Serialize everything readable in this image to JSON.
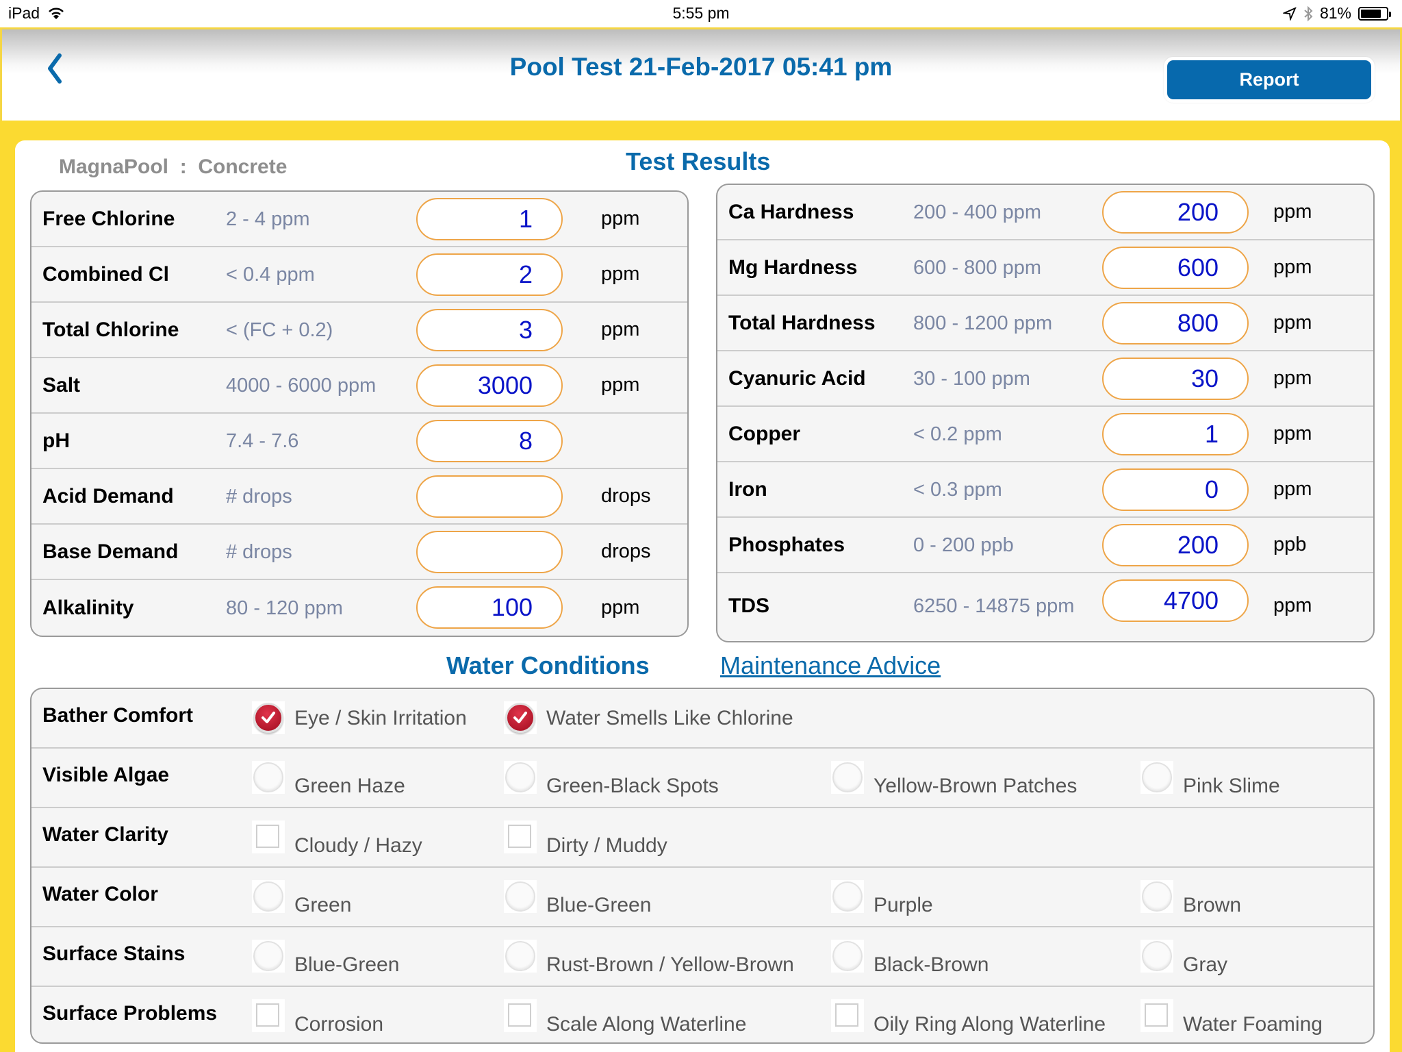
{
  "status_bar": {
    "device": "iPad",
    "time": "5:55 pm",
    "battery_percent": "81%",
    "battery_level": 0.81
  },
  "nav": {
    "back_icon": "chevron-left-icon",
    "title": "Pool Test 21-Feb-2017 05:41 pm",
    "report_label": "Report"
  },
  "pool_info": {
    "name": "MagnaPool",
    "separator": ":",
    "surface": "Concrete"
  },
  "test_results": {
    "title": "Test Results",
    "left": [
      {
        "name": "Free Chlorine",
        "range": "2 - 4 ppm",
        "value": "1",
        "unit": "ppm"
      },
      {
        "name": "Combined Cl",
        "range": "< 0.4 ppm",
        "value": "2",
        "unit": "ppm"
      },
      {
        "name": "Total Chlorine",
        "range": "< (FC + 0.2)",
        "value": "3",
        "unit": "ppm"
      },
      {
        "name": "Salt",
        "range": "4000 - 6000 ppm",
        "value": "3000",
        "unit": "ppm"
      },
      {
        "name": "pH",
        "range": "7.4 - 7.6",
        "value": "8",
        "unit": ""
      },
      {
        "name": "Acid Demand",
        "range": "# drops",
        "value": "",
        "unit": "drops"
      },
      {
        "name": "Base Demand",
        "range": "# drops",
        "value": "",
        "unit": "drops"
      },
      {
        "name": "Alkalinity",
        "range": "80 - 120 ppm",
        "value": "100",
        "unit": "ppm"
      }
    ],
    "right": [
      {
        "name": "Ca Hardness",
        "range": "200 - 400 ppm",
        "value": "200",
        "unit": "ppm"
      },
      {
        "name": "Mg Hardness",
        "range": "600 - 800 ppm",
        "value": "600",
        "unit": "ppm"
      },
      {
        "name": "Total Hardness",
        "range": "800 - 1200 ppm",
        "value": "800",
        "unit": "ppm"
      },
      {
        "name": "Cyanuric Acid",
        "range": "30 - 100 ppm",
        "value": "30",
        "unit": "ppm"
      },
      {
        "name": "Copper",
        "range": "< 0.2 ppm",
        "value": "1",
        "unit": "ppm"
      },
      {
        "name": "Iron",
        "range": "< 0.3 ppm",
        "value": "0",
        "unit": "ppm"
      },
      {
        "name": "Phosphates",
        "range": "0 - 200 ppb",
        "value": "200",
        "unit": "ppb"
      },
      {
        "name": "TDS",
        "range": "6250 - 14875 ppm",
        "value": "4700",
        "unit": "ppm"
      }
    ]
  },
  "water_conditions": {
    "title": "Water Conditions",
    "advice_link": "Maintenance Advice",
    "rows": [
      {
        "name": "Bather Comfort",
        "type": "check",
        "options": [
          {
            "label": "Eye / Skin Irritation",
            "checked": true
          },
          {
            "label": "Water Smells Like Chlorine",
            "checked": true
          }
        ]
      },
      {
        "name": "Visible Algae",
        "type": "radio",
        "options": [
          {
            "label": "Green Haze",
            "checked": false
          },
          {
            "label": "Green-Black Spots",
            "checked": false
          },
          {
            "label": "Yellow-Brown Patches",
            "checked": false
          },
          {
            "label": "Pink Slime",
            "checked": false
          }
        ]
      },
      {
        "name": "Water Clarity",
        "type": "box",
        "options": [
          {
            "label": "Cloudy / Hazy",
            "checked": false
          },
          {
            "label": "Dirty / Muddy",
            "checked": false
          }
        ]
      },
      {
        "name": "Water Color",
        "type": "radio",
        "options": [
          {
            "label": "Green",
            "checked": false
          },
          {
            "label": "Blue-Green",
            "checked": false
          },
          {
            "label": "Purple",
            "checked": false
          },
          {
            "label": "Brown",
            "checked": false
          }
        ]
      },
      {
        "name": "Surface Stains",
        "type": "radio",
        "options": [
          {
            "label": "Blue-Green",
            "checked": false
          },
          {
            "label": "Rust-Brown / Yellow-Brown",
            "checked": false
          },
          {
            "label": "Black-Brown",
            "checked": false
          },
          {
            "label": "Gray",
            "checked": false
          }
        ]
      },
      {
        "name": "Surface Problems",
        "type": "box",
        "options": [
          {
            "label": "Corrosion",
            "checked": false
          },
          {
            "label": "Scale Along Waterline",
            "checked": false
          },
          {
            "label": "Oily Ring Along Waterline",
            "checked": false
          },
          {
            "label": "Water Foaming",
            "checked": false
          }
        ]
      }
    ]
  },
  "colors": {
    "accent": "#0a6aab",
    "report_button": "#0769ad",
    "frame_yellow": "#fbda31",
    "value_text": "#0a14c8",
    "input_border": "#eea548",
    "range_text": "#7a86a3",
    "checked_red": "#c0182c"
  }
}
